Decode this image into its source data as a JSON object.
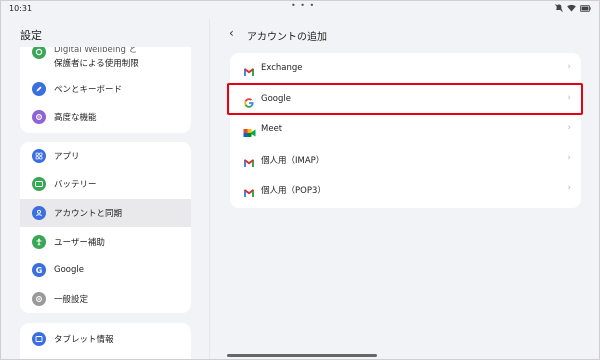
{
  "status": {
    "time": "10:31",
    "dots": "• • •",
    "icons": [
      "mute-icon",
      "wifi-icon",
      "battery-icon"
    ]
  },
  "left": {
    "title": "設定",
    "group1": [
      {
        "label": "Digital Wellbeing と",
        "label2": "保護者による使用制限",
        "icon": "digital-wellbeing-icon",
        "color": "#3aa757"
      },
      {
        "label": "ペンとキーボード",
        "icon": "pen-icon",
        "color": "#3b6fe0"
      },
      {
        "label": "高度な機能",
        "icon": "advanced-icon",
        "color": "#8e63d6"
      }
    ],
    "group2": [
      {
        "label": "アプリ",
        "icon": "apps-icon",
        "color": "#3b6fe0"
      },
      {
        "label": "バッテリー",
        "icon": "battery-icon",
        "color": "#3aa757"
      },
      {
        "label": "アカウントと同期",
        "icon": "account-icon",
        "color": "#3b6fe0",
        "active": true
      },
      {
        "label": "ユーザー補助",
        "icon": "accessibility-icon",
        "color": "#3aa757"
      },
      {
        "label": "Google",
        "icon": "google-icon",
        "color": "#3b6fe0"
      },
      {
        "label": "一般設定",
        "icon": "general-settings-icon",
        "color": "#9a9a9a"
      }
    ],
    "group3": [
      {
        "label": "タブレット情報",
        "icon": "tablet-info-icon",
        "color": "#3b6fe0"
      }
    ]
  },
  "right": {
    "back": "‹",
    "title": "アカウントの追加",
    "items": [
      {
        "label": "Exchange",
        "icon": "gmail-icon"
      },
      {
        "label": "Google",
        "icon": "google-g-icon"
      },
      {
        "label": "Meet",
        "icon": "meet-icon"
      },
      {
        "label": "個人用（IMAP）",
        "icon": "gmail-icon"
      },
      {
        "label": "個人用（POP3）",
        "icon": "gmail-icon"
      }
    ],
    "chevron": "›"
  },
  "colors": {
    "highlight": "#e60012",
    "background": "#f1f3f6",
    "card": "#ffffff"
  }
}
